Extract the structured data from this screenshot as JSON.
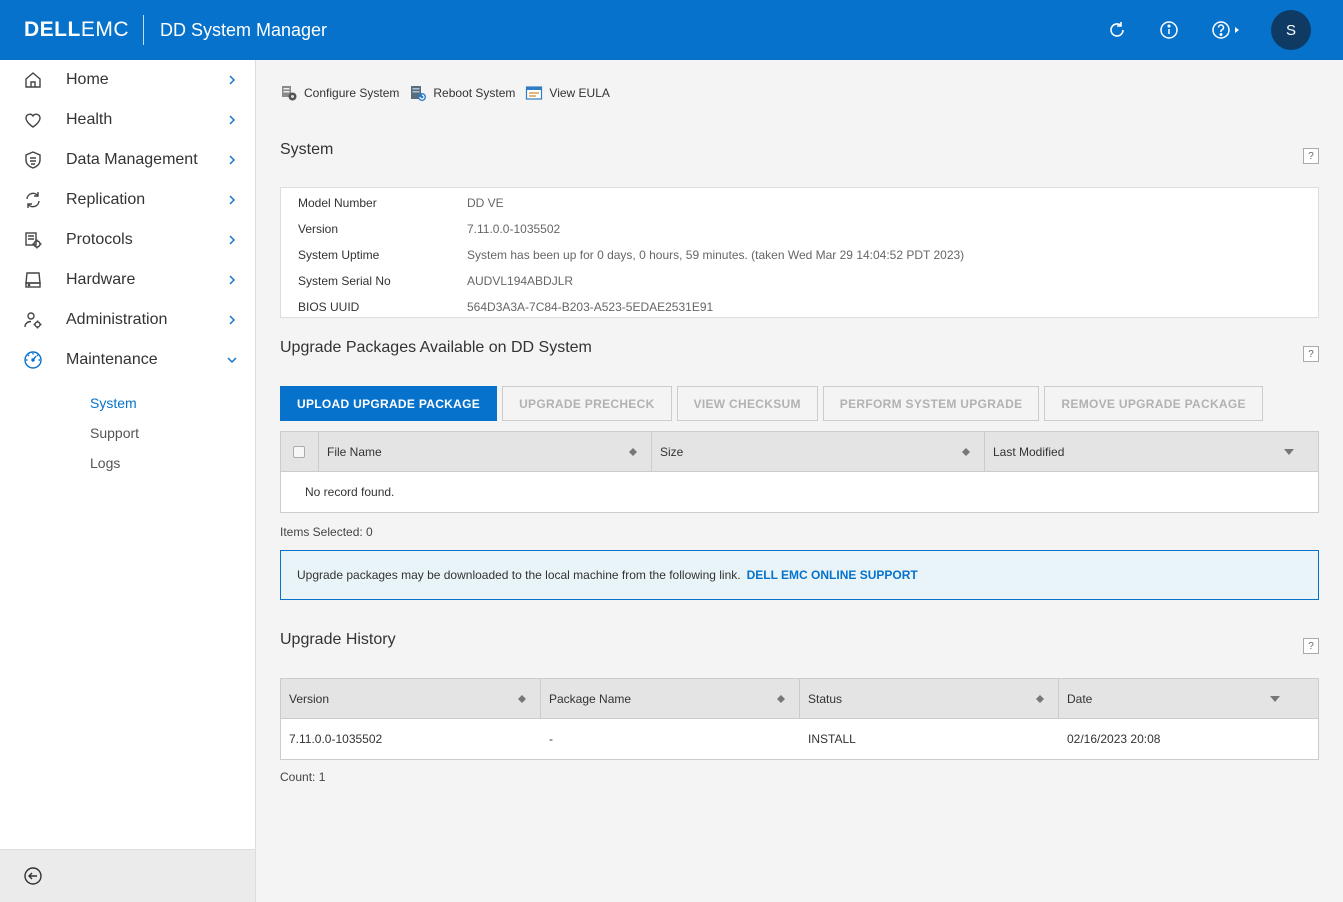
{
  "header": {
    "logo_bold": "DELL",
    "logo_light": "EMC",
    "app_title": "DD System Manager",
    "refresh_icon": "refresh-icon",
    "info_icon": "info-icon",
    "help_icon": "help-icon",
    "user_initial": "S",
    "accent": "#0672cb"
  },
  "sidebar": {
    "items": [
      {
        "label": "Home",
        "icon": "home-icon"
      },
      {
        "label": "Health",
        "icon": "heart-icon"
      },
      {
        "label": "Data Management",
        "icon": "shield-icon"
      },
      {
        "label": "Replication",
        "icon": "sync-icon"
      },
      {
        "label": "Protocols",
        "icon": "protocol-gear-icon"
      },
      {
        "label": "Hardware",
        "icon": "drive-icon"
      },
      {
        "label": "Administration",
        "icon": "user-gear-icon"
      },
      {
        "label": "Maintenance",
        "icon": "clock-gauge-icon"
      }
    ],
    "subitems": [
      {
        "label": "System",
        "active": true
      },
      {
        "label": "Support",
        "active": false
      },
      {
        "label": "Logs",
        "active": false
      }
    ]
  },
  "toolbar": {
    "configure": "Configure System",
    "reboot": "Reboot System",
    "eula": "View EULA"
  },
  "system": {
    "title": "System",
    "help": "?",
    "rows": [
      {
        "key": "Model Number",
        "value": "DD VE"
      },
      {
        "key": "Version",
        "value": "7.11.0.0-1035502"
      },
      {
        "key": "System Uptime",
        "value": "System has been up for 0 days, 0 hours, 59 minutes. (taken Wed Mar 29 14:04:52 PDT 2023)"
      },
      {
        "key": "System Serial No",
        "value": "AUDVL194ABDJLR"
      },
      {
        "key": "BIOS UUID",
        "value": "564D3A3A-7C84-B203-A523-5EDAE2531E91"
      }
    ]
  },
  "upgrade": {
    "title": "Upgrade Packages Available on DD System",
    "help": "?",
    "buttons": {
      "upload": "UPLOAD UPGRADE PACKAGE",
      "precheck": "UPGRADE PRECHECK",
      "checksum": "VIEW CHECKSUM",
      "perform": "PERFORM SYSTEM UPGRADE",
      "remove": "REMOVE UPGRADE PACKAGE"
    },
    "columns": [
      "File Name",
      "Size",
      "Last Modified"
    ],
    "empty": "No record found.",
    "items_selected": "Items Selected: 0",
    "info_text": "Upgrade packages may be downloaded to the local machine from the following link.",
    "info_link": "DELL EMC ONLINE SUPPORT"
  },
  "history": {
    "title": "Upgrade History",
    "help": "?",
    "columns": [
      "Version",
      "Package Name",
      "Status",
      "Date"
    ],
    "rows": [
      {
        "version": "7.11.0.0-1035502",
        "package": "-",
        "status": "INSTALL",
        "date": "02/16/2023 20:08"
      }
    ],
    "count": "Count: 1"
  }
}
